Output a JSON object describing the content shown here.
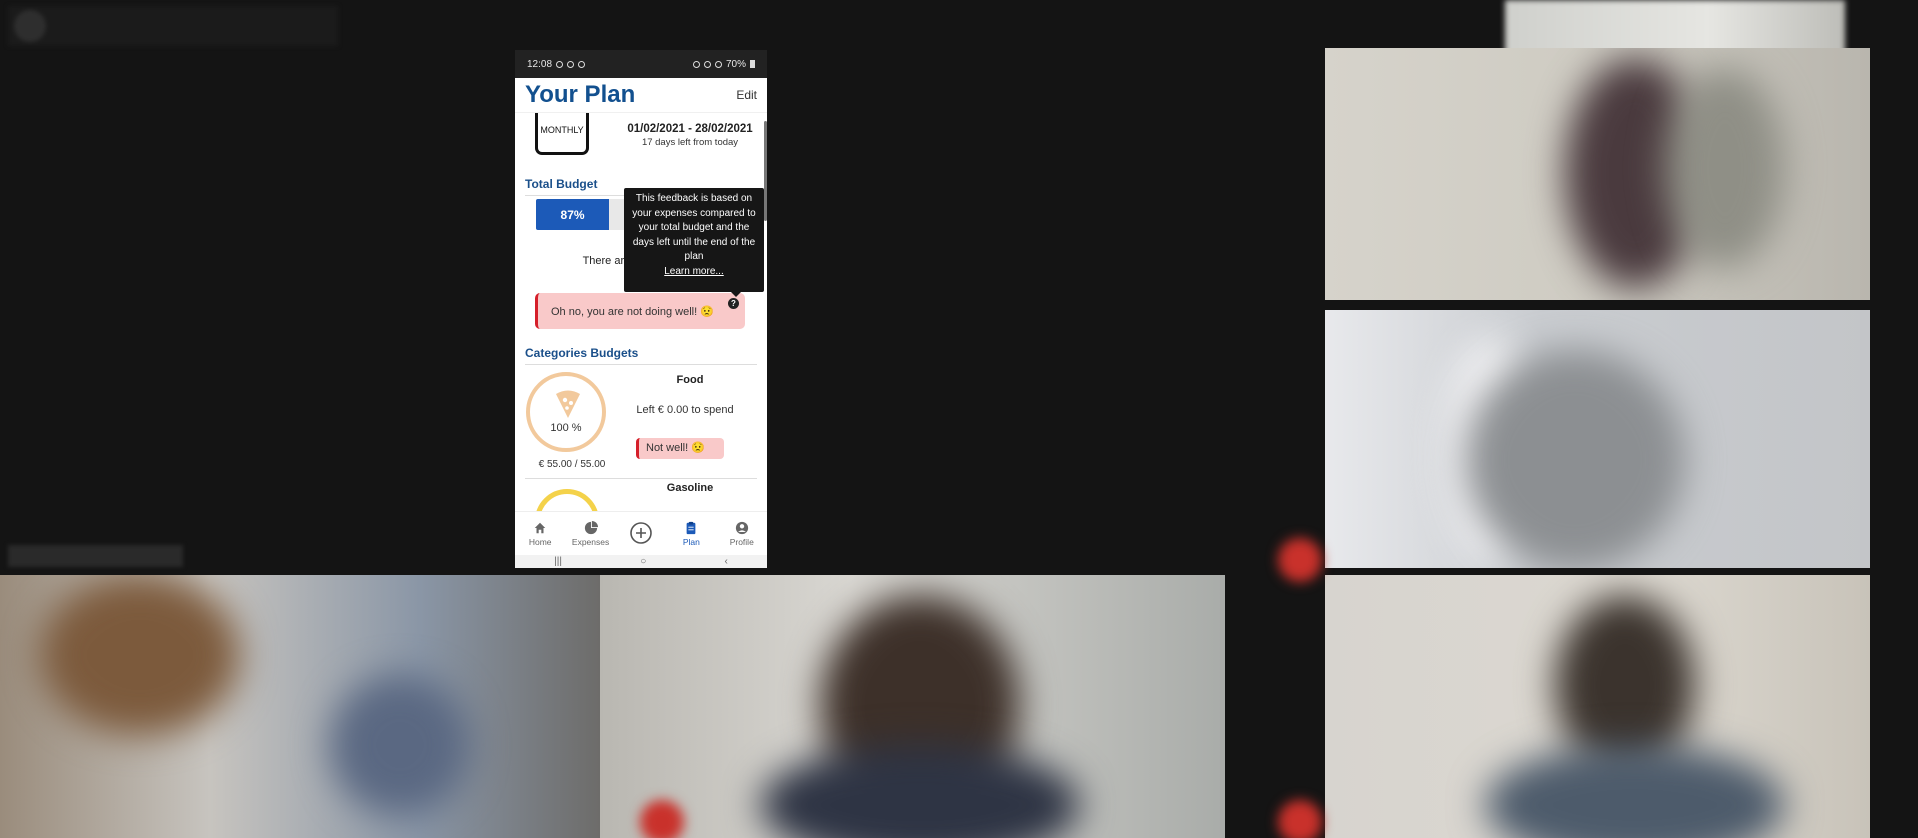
{
  "phone": {
    "status": {
      "time": "12:08",
      "battery": "70%"
    },
    "header": {
      "title": "Your Plan",
      "edit": "Edit"
    },
    "plan": {
      "frequency": "MONTHLY",
      "date_range": "01/02/2021 - 28/02/2021",
      "days_left": "17 days left from today"
    },
    "total_budget": {
      "title": "Total Budget",
      "progress_percent": 87,
      "progress_label": "87%",
      "remaining_text": "There are €"
    },
    "tooltip": {
      "text": "This feedback is based on your expenses compared to your total budget and the days left until the end of the plan",
      "link": "Learn more..."
    },
    "feedback": {
      "text": "Oh no, you are not doing well! 😟",
      "help": "?"
    },
    "categories": {
      "title": "Categories Budgets",
      "items": [
        {
          "name": "Food",
          "percent": "100 %",
          "left": "Left € 0.00 to spend",
          "status": "Not well! 😟",
          "amount": "€ 55.00 / 55.00",
          "color": "#f2c99c"
        },
        {
          "name": "Gasoline",
          "color": "#f4d24a"
        }
      ]
    },
    "nav": {
      "items": [
        {
          "label": "Home",
          "icon": "home-icon"
        },
        {
          "label": "Expenses",
          "icon": "pie-chart-icon"
        },
        {
          "label": "",
          "icon": "plus-circle-icon"
        },
        {
          "label": "Plan",
          "icon": "clipboard-icon",
          "active": true
        },
        {
          "label": "Profile",
          "icon": "user-icon"
        }
      ]
    }
  },
  "colors": {
    "brand": "#12508f",
    "accent": "#1c5ab8",
    "danger": "#d51f2a",
    "danger_bg": "#f9c9c9"
  }
}
